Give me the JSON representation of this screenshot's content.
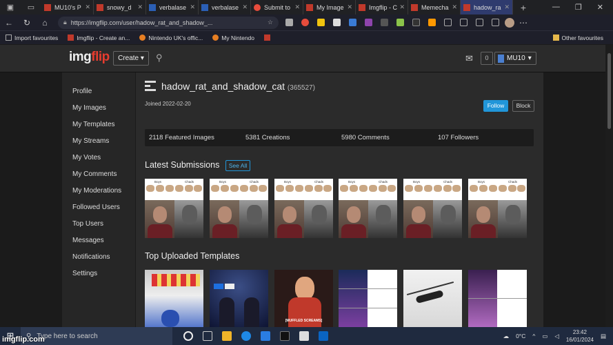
{
  "browser": {
    "tabs": [
      {
        "label": "MU10's P"
      },
      {
        "label": "snowy_d"
      },
      {
        "label": "verbalase"
      },
      {
        "label": "verbalase"
      },
      {
        "label": "Submit to"
      },
      {
        "label": "My Image"
      },
      {
        "label": "Imgflip - C"
      },
      {
        "label": "Memecha"
      },
      {
        "label": "hadow_ra"
      }
    ],
    "new_tab": "+",
    "url": "https://imgflip.com/user/hadow_rat_and_shadow_...",
    "favourites": [
      {
        "label": "Import favourites"
      },
      {
        "label": "Imgflip - Create an..."
      },
      {
        "label": "Nintendo UK's offic..."
      },
      {
        "label": "My Nintendo"
      }
    ],
    "other_favourites": "Other favourites"
  },
  "site": {
    "logo_a": "img",
    "logo_b": "flip",
    "create_label": "Create ▾",
    "notif_count": "0",
    "username": "MU10",
    "user_caret": "▾"
  },
  "sidebar": {
    "items": [
      {
        "label": "Profile"
      },
      {
        "label": "My Images"
      },
      {
        "label": "My Templates"
      },
      {
        "label": "My Streams"
      },
      {
        "label": "My Votes"
      },
      {
        "label": "My Comments"
      },
      {
        "label": "My Moderations"
      },
      {
        "label": "Followed Users"
      },
      {
        "label": "Top Users"
      },
      {
        "label": "Messages"
      },
      {
        "label": "Notifications"
      },
      {
        "label": "Settings"
      }
    ]
  },
  "profile": {
    "username": "hadow_rat_and_shadow_cat",
    "points": "(365527)",
    "joined": "Joined 2022-02-20",
    "follow_label": "Follow",
    "block_label": "Block",
    "stats": {
      "featured": "2118 Featured Images",
      "creations": "5381 Creations",
      "comments": "5980 Comments",
      "followers": "107 Followers"
    },
    "latest_title": "Latest Submissions",
    "see_all": "See All",
    "meme_top_left": "Boys",
    "meme_top_right": "Chads",
    "templates_title": "Top Uploaded Templates",
    "template_caption": "[MUFFLED SCREAMS]"
  },
  "taskbar": {
    "search_placeholder": "Type here to search",
    "weather": "0°C",
    "time": "23:42",
    "date": "16/01/2024",
    "watermark": "imgflip.com"
  }
}
